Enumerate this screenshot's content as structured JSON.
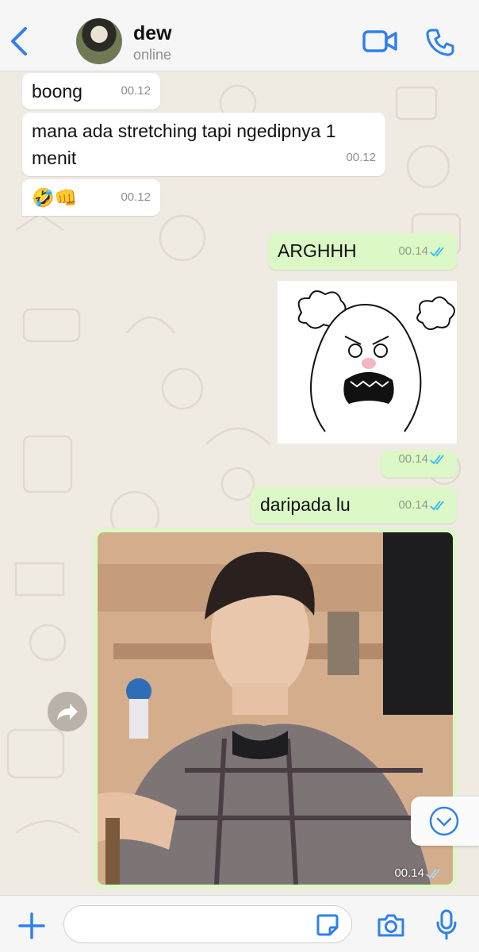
{
  "header": {
    "contact_name": "dew",
    "contact_status": "online",
    "back_icon": "chevron-left-icon",
    "video_icon": "video-camera-icon",
    "call_icon": "phone-icon",
    "accent_color": "#2f80ed"
  },
  "messages": [
    {
      "direction": "incoming",
      "text": "boong",
      "time": "00.12"
    },
    {
      "direction": "incoming",
      "text": "mana ada stretching tapi ngedipnya 1 menit",
      "time": "00.12"
    },
    {
      "direction": "incoming",
      "text": "🤣👊",
      "time": "00.12"
    },
    {
      "direction": "outgoing",
      "text": "ARGHHH",
      "time": "00.14",
      "status": "read"
    },
    {
      "direction": "outgoing",
      "type": "sticker",
      "sticker": "angry-creature-sticker",
      "time": "00.14",
      "status": "read"
    },
    {
      "direction": "outgoing",
      "text": "daripada lu",
      "time": "00.14",
      "status": "read"
    },
    {
      "direction": "outgoing",
      "type": "photo",
      "time": "00.14",
      "status": "read"
    }
  ],
  "colors": {
    "incoming_bubble": "#ffffff",
    "outgoing_bubble": "#dcf8c6",
    "read_ticks": "#34b7f1",
    "wallpaper": "#efeae2"
  },
  "composer": {
    "placeholder": "",
    "plus_icon": "plus-icon",
    "sticker_icon": "sticker-icon",
    "camera_icon": "camera-icon",
    "mic_icon": "microphone-icon"
  }
}
